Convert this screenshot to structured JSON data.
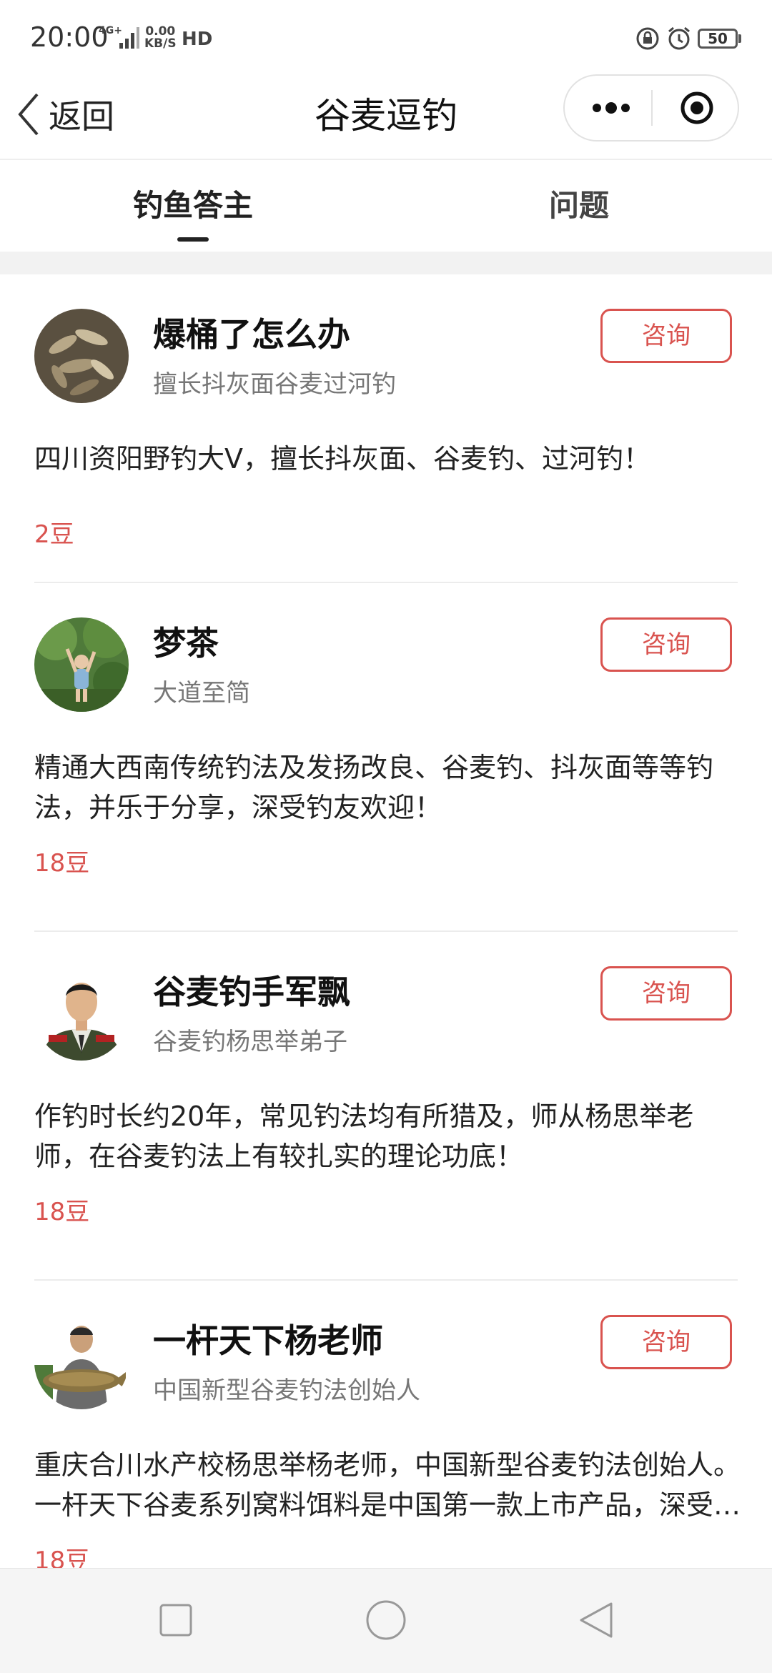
{
  "status_bar": {
    "time": "20:00",
    "network": "4G+",
    "speed_value": "0.00",
    "speed_unit": "KB/S",
    "hd": "HD",
    "battery": "50"
  },
  "nav": {
    "back_label": "返回",
    "title": "谷麦逗钓"
  },
  "tabs": [
    {
      "label": "钓鱼答主",
      "active": true
    },
    {
      "label": "问题",
      "active": false
    }
  ],
  "experts": [
    {
      "name": "爆桶了怎么办",
      "subtitle": "擅长抖灰面谷麦过河钓",
      "button": "咨询",
      "description": "四川资阳野钓大V，擅长抖灰面、谷麦钓、过河钓！",
      "price": "2豆",
      "avatar_icon": "fish-pile-avatar"
    },
    {
      "name": "梦茶",
      "subtitle": "大道至简",
      "button": "咨询",
      "description": "精通大西南传统钓法及发扬改良、谷麦钓、抖灰面等等钓法，并乐于分享，深受钓友欢迎！",
      "price": "18豆",
      "avatar_icon": "child-tree-avatar"
    },
    {
      "name": "谷麦钓手军飘",
      "subtitle": "谷麦钓杨思举弟子",
      "button": "咨询",
      "description": "作钓时长约20年，常见钓法均有所猎及，师从杨思举老师，在谷麦钓法上有较扎实的理论功底！",
      "price": "18豆",
      "avatar_icon": "uniform-portrait-avatar"
    },
    {
      "name": "一杆天下杨老师",
      "subtitle": "中国新型谷麦钓法创始人",
      "button": "咨询",
      "description": "重庆合川水产校杨思举杨老师，中国新型谷麦钓法创始人。一杆天下谷麦系列窝料饵料是中国第一款上市产品，深受广大钓友喜爱！",
      "price": "18豆",
      "avatar_icon": "man-with-fish-avatar"
    }
  ],
  "colors": {
    "accent": "#d9534f",
    "text": "#222222",
    "muted": "#777777",
    "divider": "#ececec"
  }
}
